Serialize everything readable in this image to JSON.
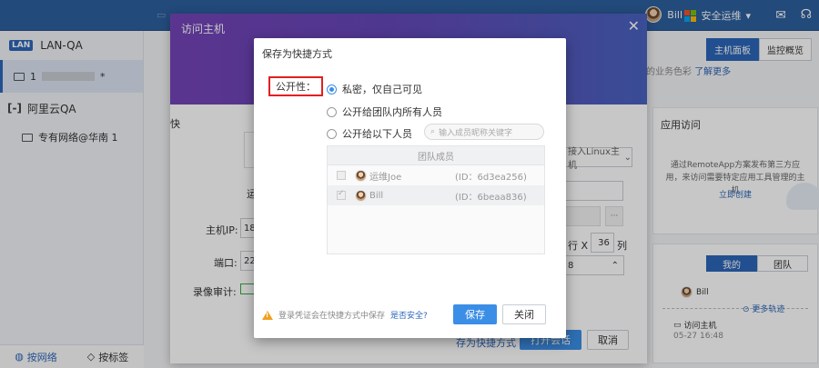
{
  "app": {
    "lan_badge": "LAN",
    "lan_name": "LAN-QA",
    "host_prefix": "1",
    "host_suffix": "*",
    "aliyun_logo": "[-]",
    "aliyun_name": "阿里云QA",
    "network_name": "专有网络@华南 1",
    "user_name": "Bill",
    "ops_name": "安全运维",
    "tab_console": "主机面板",
    "tab_monitor": "监控概览",
    "notice_text": "的业务色彩",
    "notice_link": "了解更多",
    "bottom_tab_network": "按网络",
    "bottom_tab_tag": "按标签",
    "app_access_title": "应用访问",
    "app_access_desc": "通过RemoteApp方案发布第三方应用，来访问需要特定应用工具管理的主机",
    "app_access_link": "立即创建",
    "seg_mine": "我的",
    "seg_team": "团队",
    "activity_user": "Bill",
    "more_track": "更多轨迹",
    "activity_event": "访问主机",
    "activity_time": "05-27 16:48"
  },
  "outer_dialog": {
    "title": "访问主机",
    "left_stub_1": "快",
    "left_stub_2": "运",
    "host_ip_label": "主机IP:",
    "host_ip_value": "18",
    "port_label": "端口:",
    "port_value": "22",
    "record_label": "录像审计:",
    "select_text": "接入Linux主机",
    "rows_label": "行 X",
    "cols_value": "36",
    "cols_label": "列",
    "encoding_value": "8",
    "save_shortcut_link": "存为快捷方式",
    "open_session_button": "打开会话",
    "cancel_button": "取消"
  },
  "inner_dialog": {
    "title": "保存为快捷方式",
    "publicity_label": "公开性：",
    "options": [
      {
        "label": "私密，仅自己可见",
        "selected": true
      },
      {
        "label": "公开给团队内所有人员",
        "selected": false
      },
      {
        "label": "公开给以下人员",
        "selected": false
      }
    ],
    "member_search_placeholder": "输入成员昵称关键字",
    "member_table_header": "团队成员",
    "members": [
      {
        "name": "运维Joe",
        "id": "(ID：6d3ea256)",
        "checked": false
      },
      {
        "name": "Bill",
        "id": "(ID：6beaa836)",
        "checked": true
      }
    ],
    "warning_text": "登录凭证会在快捷方式中保存",
    "warning_link": "是否安全?",
    "save_button": "保存",
    "close_button": "关闭"
  },
  "colors": {
    "primary": "#3b8ee6",
    "topbar": "#2c5f9e",
    "highlight_border": "#e02020",
    "dialog_gradient_start": "#7444b8",
    "dialog_gradient_end": "#4a62c0"
  }
}
